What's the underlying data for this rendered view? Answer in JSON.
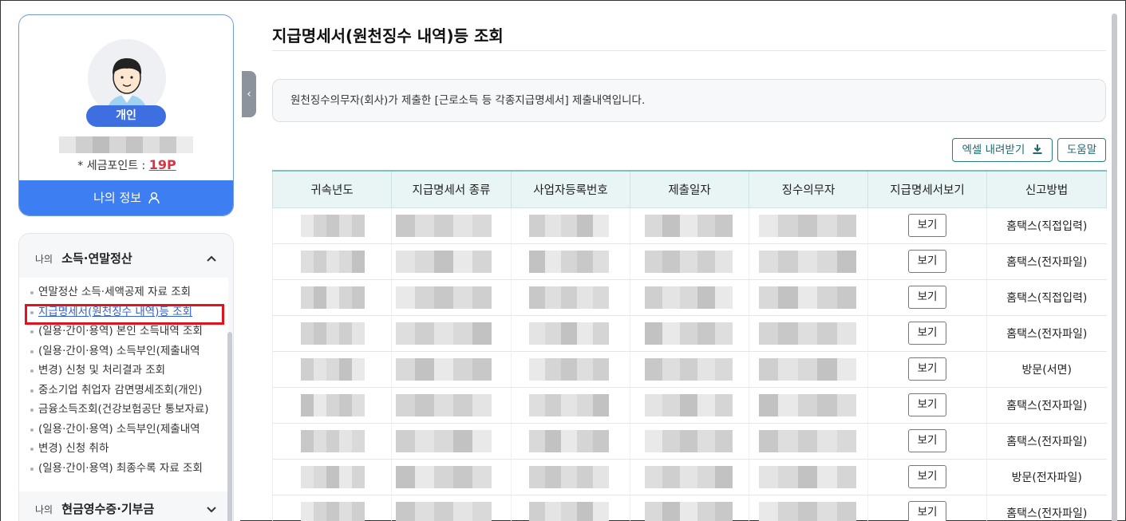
{
  "profile": {
    "badge": "개인",
    "points_label": "* 세금포인트 :",
    "points_value": "19P",
    "my_info": "나의 정보"
  },
  "menu": {
    "section1_prefix": "나의",
    "section1_title": "소득·연말정산",
    "items": [
      "연말정산 소득·세액공제 자료 조회",
      "지급명세서(원천징수 내역)등 조회",
      "(일용·간이·용역) 본인 소득내역 조회",
      "(일용·간이·용역) 소득부인(제출내역",
      "변경) 신청 및 처리결과 조회",
      "중소기업 취업자 감면명세조회(개인)",
      "금융소득조회(건강보험공단 통보자료)",
      "(일용·간이·용역) 소득부인(제출내역",
      "변경) 신청 취하",
      "(일용·간이·용역) 최종수록 자료 조회"
    ],
    "section2_prefix": "나의",
    "section2_title": "현금영수증·기부금"
  },
  "main": {
    "title": "지급명세서(원천징수 내역)등 조회",
    "notice": "원천징수의무자(회사)가 제출한 [근로소득 등 각종지급명세서] 제출내역입니다.",
    "excel_button": "엑셀 내려받기",
    "help_button": "도움말",
    "columns": [
      "귀속년도",
      "지급명세서 종류",
      "사업자등록번호",
      "제출일자",
      "징수의무자",
      "지급명세서보기",
      "신고방법"
    ],
    "view_label": "보기",
    "rows": [
      {
        "method": "홈택스(직접입력)"
      },
      {
        "method": "홈택스(전자파일)"
      },
      {
        "method": "홈택스(직접입력)"
      },
      {
        "method": "홈택스(전자파일)"
      },
      {
        "method": "방문(서면)"
      },
      {
        "method": "홈택스(전자파일)"
      },
      {
        "method": "홈택스(전자파일)"
      },
      {
        "method": "방문(전자파일)"
      },
      {
        "method": "홈택스(전자파일)"
      }
    ]
  },
  "colors": {
    "accent": "#3d7ef2",
    "table_header": "#e9f4f5",
    "highlight": "#e0141e"
  }
}
